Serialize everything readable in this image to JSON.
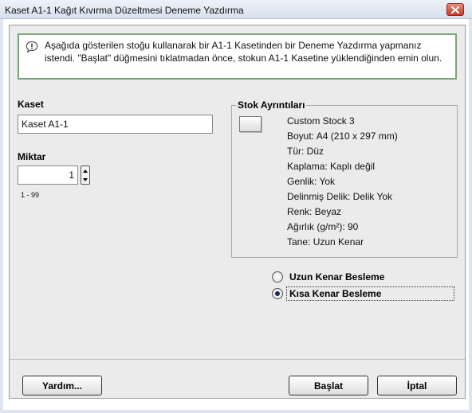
{
  "window": {
    "title": "Kaset A1-1 Kağıt Kıvırma Düzeltmesi Deneme Yazdırma"
  },
  "info": {
    "icon": "speech-bubble-exclamation-icon",
    "text": "Aşağıda gösterilen stoğu kullanarak bir A1-1 Kasetinden bir Deneme Yazdırma yapmanız istendi. \"Başlat\" düğmesini tıklatmadan önce, stokun A1-1 Kasetine yüklendiğinden emin olun."
  },
  "tray": {
    "label": "Kaset",
    "value": "Kaset A1-1"
  },
  "quantity": {
    "label": "Miktar",
    "value": "1",
    "range": "1 - 99"
  },
  "stock": {
    "legend": "Stok Ayrıntıları",
    "lines": [
      "Custom Stock 3",
      "Boyut: A4 (210 x 297 mm)",
      "Tür: Düz",
      "Kaplama: Kaplı değil",
      "Genlik: Yok",
      "Delinmiş Delik: Delik Yok",
      "Renk: Beyaz",
      "Ağırlık (g/m²): 90",
      "Tane: Uzun Kenar"
    ]
  },
  "feed": {
    "options": [
      "Uzun Kenar Besleme",
      "Kısa Kenar Besleme"
    ],
    "selected": "Kısa Kenar Besleme"
  },
  "buttons": {
    "help": "Yardım...",
    "start": "Başlat",
    "cancel": "İptal"
  }
}
